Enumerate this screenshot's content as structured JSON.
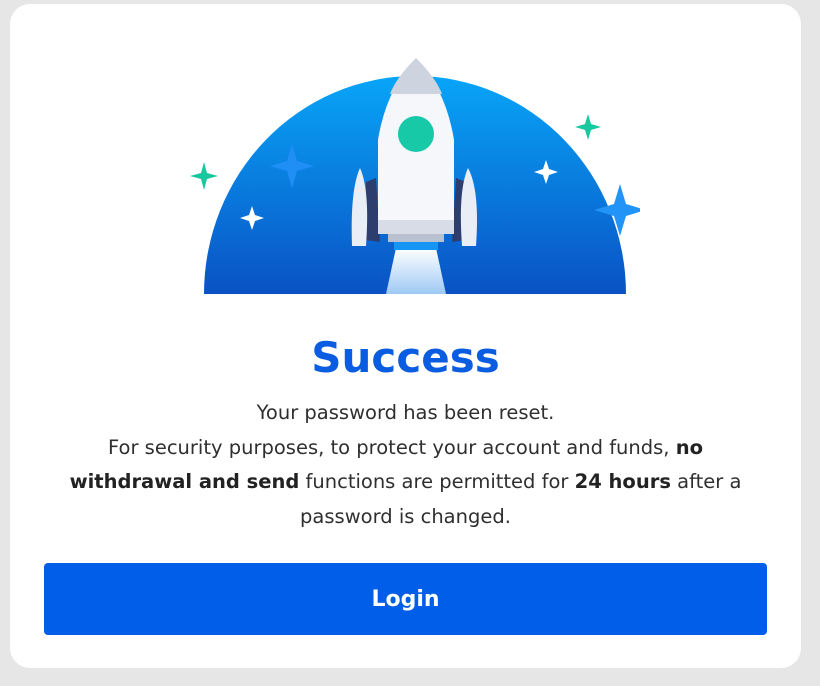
{
  "dialog": {
    "title": "Success",
    "line1": "Your password has been reset.",
    "line2_a": "For security purposes, to protect your account and funds, ",
    "line2_b_bold": "no withdrawal and send",
    "line2_c": " functions are permitted for ",
    "line2_d_bold": "24 hours",
    "line2_e": " after a password is changed.",
    "login_label": "Login"
  },
  "colors": {
    "accent": "#005ee8",
    "title": "#0a5ce0",
    "dome_top": "#0aa0f5",
    "dome_bottom": "#0a56c8",
    "sparkle_green": "#18c9a0",
    "sparkle_blue": "#1a8cf0"
  },
  "icons": {
    "illustration": "rocket-launch-illustration"
  }
}
